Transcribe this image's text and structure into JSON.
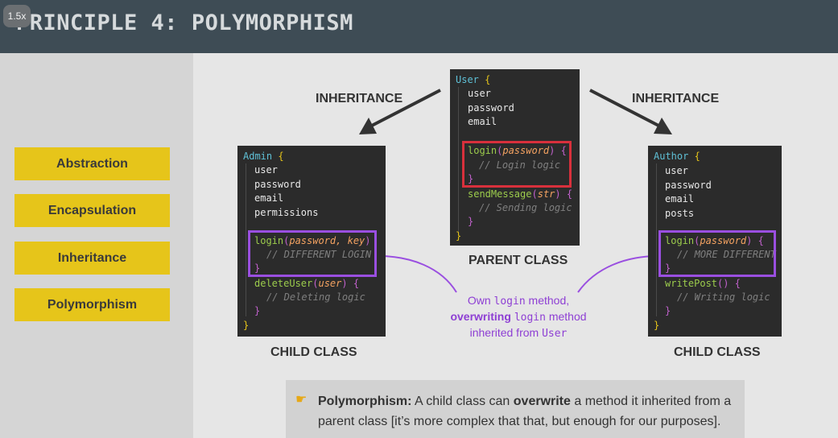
{
  "header": {
    "title": "PRINCIPLE 4: POLYMORPHISM",
    "badge": "1.5x"
  },
  "sidebar": {
    "items": [
      "Abstraction",
      "Encapsulation",
      "Inheritance",
      "Polymorphism"
    ]
  },
  "labels": {
    "inheritance_left": "INHERITANCE",
    "inheritance_right": "INHERITANCE",
    "parent": "PARENT CLASS",
    "child_left": "CHILD CLASS",
    "child_right": "CHILD CLASS"
  },
  "user_code": {
    "cls": "User",
    "brace": "{",
    "props": [
      "user",
      "password",
      "email"
    ],
    "m1_name": "login",
    "m1_args": "password",
    "m1_open": ") {",
    "m1_comment": "// Login logic",
    "m2_name": "sendMessage",
    "m2_args": "str",
    "m2_open": ") {",
    "m2_comment": "// Sending logic",
    "close": "}"
  },
  "admin_code": {
    "cls": "Admin",
    "brace": "{",
    "props": [
      "user",
      "password",
      "email",
      "permissions"
    ],
    "m1_name": "login",
    "m1_args": "password, key",
    "m1_open": ")",
    "m1_comment": "// DIFFERENT LOGIN",
    "m2_name": "deleteUser",
    "m2_args": "user",
    "m2_open": ") {",
    "m2_comment": "// Deleting logic",
    "close": "}"
  },
  "author_code": {
    "cls": "Author",
    "brace": "{",
    "props": [
      "user",
      "password",
      "email",
      "posts"
    ],
    "m1_name": "login",
    "m1_args": "password",
    "m1_open": ") {",
    "m1_comment": "// MORE DIFFERENT",
    "m2_name": "writePost",
    "m2_args": "",
    "m2_open": "() {",
    "m2_comment": "// Writing logic",
    "close": "}"
  },
  "note": {
    "line1_a": "Own ",
    "line1_code": "login",
    "line1_b": " method,",
    "line2_bold": "overwriting",
    "line2_code": "login",
    "line2_b": " method",
    "line3_a": "inherited from ",
    "line3_code": "User"
  },
  "footer": {
    "icon": "pointing-hand-icon",
    "term": "Polymorphism:",
    "text_a": " A child class can ",
    "bold": "overwrite",
    "text_b": " a method it inherited from a parent class [it’s more complex that that, but enough for our purposes]."
  },
  "colors": {
    "accent_yellow": "#e6c51a",
    "highlight_red": "#d8303c",
    "highlight_purple": "#9a4fe0",
    "header": "#3e4c55"
  }
}
